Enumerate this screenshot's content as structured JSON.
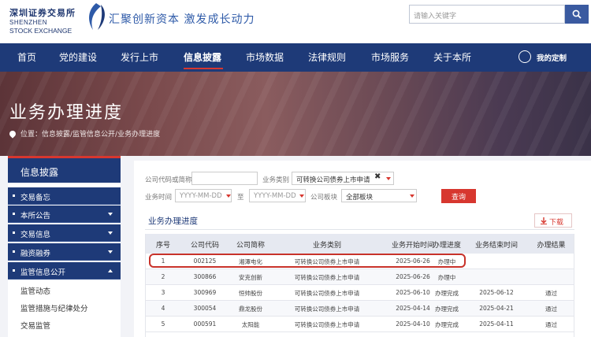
{
  "header": {
    "logo_cn": "深圳证券交易所",
    "logo_en1": "SHENZHEN",
    "logo_en2": "STOCK EXCHANGE",
    "slogan": "汇聚创新资本 激发成长动力",
    "search_placeholder": "请输入关键字"
  },
  "nav": {
    "items": [
      "首页",
      "党的建设",
      "发行上市",
      "信息披露",
      "市场数据",
      "法律规则",
      "市场服务",
      "关于本所"
    ],
    "active": "信息披露",
    "custom_label": "我的定制"
  },
  "banner": {
    "title": "业务办理进度",
    "breadcrumb": "位置：信息披露/监管信息公开/业务办理进度"
  },
  "sidebar": {
    "title": "信息披露",
    "items": [
      {
        "label": "交易备忘",
        "caret": false
      },
      {
        "label": "本所公告",
        "caret": true
      },
      {
        "label": "交易信息",
        "caret": true
      },
      {
        "label": "融资融券",
        "caret": true
      },
      {
        "label": "监管信息公开",
        "caret": true,
        "expanded": true
      }
    ],
    "subitems": [
      "监管动态",
      "监管措施与纪律处分",
      "交易监管"
    ]
  },
  "filters": {
    "code_label": "公司代码或简称",
    "type_label": "业务类别",
    "type_value": "可转换公司债券上市申请",
    "time_label": "业务时间",
    "date_placeholder": "YYYY-MM-DD",
    "to_label": "至",
    "board_label": "公司板块",
    "board_value": "全部板块",
    "query_label": "查询"
  },
  "section": {
    "title": "业务办理进度",
    "download_label": "下载"
  },
  "table": {
    "headers": [
      "序号",
      "公司代码",
      "公司简称",
      "业务类别",
      "业务开始时间",
      "办理进度",
      "业务结束时间",
      "办理结果"
    ],
    "rows": [
      [
        "1",
        "002125",
        "湘潭电化",
        "可转换公司债券上市申请",
        "2025-06-26",
        "办理中",
        "",
        ""
      ],
      [
        "2",
        "300866",
        "安克创新",
        "可转换公司债券上市申请",
        "2025-06-26",
        "办理中",
        "",
        ""
      ],
      [
        "3",
        "300969",
        "恒帅股份",
        "可转换公司债券上市申请",
        "2025-06-10",
        "办理完成",
        "2025-06-12",
        "通过"
      ],
      [
        "4",
        "300054",
        "鼎龙股份",
        "可转换公司债券上市申请",
        "2025-04-14",
        "办理完成",
        "2025-04-21",
        "通过"
      ],
      [
        "5",
        "000591",
        "太阳能",
        "可转换公司债券上市申请",
        "2025-04-10",
        "办理完成",
        "2025-04-11",
        "通过"
      ]
    ]
  },
  "colors": {
    "navy": "#1e3a78",
    "accent_red": "#d7372f"
  }
}
